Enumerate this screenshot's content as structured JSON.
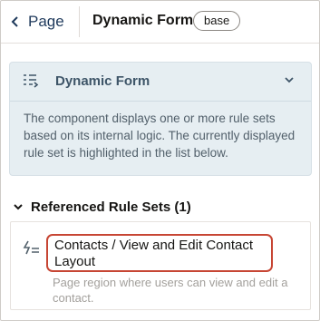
{
  "header": {
    "back_label": "Page",
    "title": "Dynamic Form",
    "badge": "base"
  },
  "info_panel": {
    "title": "Dynamic Form",
    "description": "The component displays one or more rule sets based on its internal logic. The currently displayed rule set is highlighted in the list below."
  },
  "referenced": {
    "title": "Referenced Rule Sets (1)",
    "items": [
      {
        "name": "Contacts / View and Edit Contact Layout",
        "description": "Page region where users can view and edit a contact."
      }
    ]
  },
  "colors": {
    "highlight_border": "#c74634",
    "panel_bg": "#e6eef2",
    "panel_title": "#3e5568",
    "link": "#1f3a5c"
  }
}
